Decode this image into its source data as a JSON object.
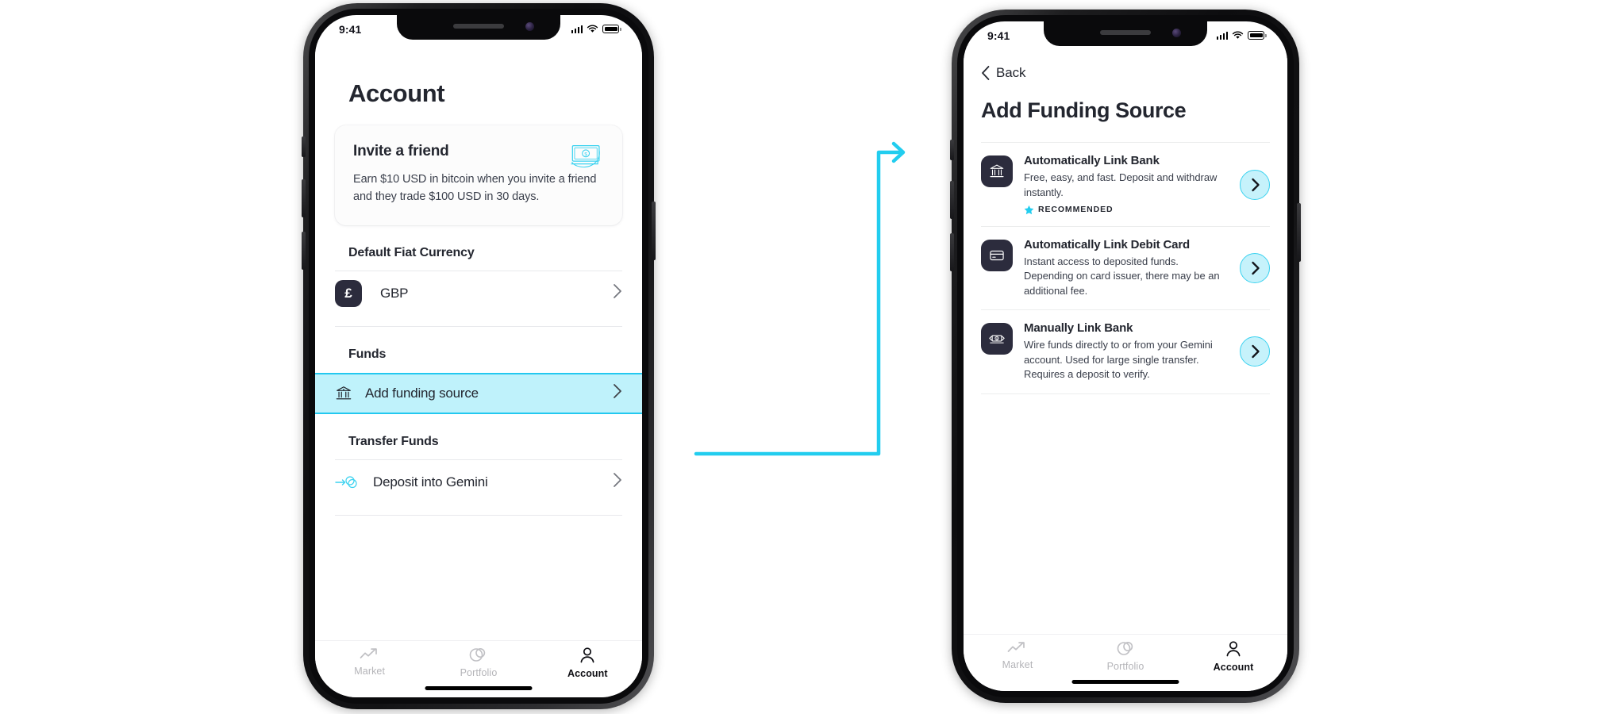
{
  "accent": "#22cdef",
  "highlight_bg": "#bff2fb",
  "dark_badge": "#2c2c3d",
  "phone1": {
    "status": {
      "time": "9:41",
      "signal": "signal-bars-icon",
      "wifi": "wifi-icon",
      "battery": "battery-full-icon"
    },
    "page_title": "Account",
    "invite": {
      "title": "Invite a friend",
      "description": "Earn $10 USD in bitcoin when you invite a friend and they trade $100 USD in 30 days.",
      "icon": "money-bill-icon"
    },
    "sections": [
      {
        "heading": "Default Fiat Currency",
        "rows": [
          {
            "badge": "£",
            "label": "GBP",
            "chevron": "chevron-right-icon",
            "highlighted": false
          }
        ]
      },
      {
        "heading": "Funds",
        "rows": [
          {
            "icon": "bank-icon",
            "label": "Add funding source",
            "chevron": "chevron-right-icon",
            "highlighted": true
          }
        ]
      },
      {
        "heading": "Transfer Funds",
        "rows": [
          {
            "icon": "deposit-arrow-icon",
            "label": "Deposit into Gemini",
            "chevron": "chevron-right-icon",
            "highlighted": false
          }
        ]
      }
    ],
    "tabs": [
      {
        "label": "Market",
        "icon": "trend-up-icon",
        "active": false
      },
      {
        "label": "Portfolio",
        "icon": "circles-icon",
        "active": false
      },
      {
        "label": "Account",
        "icon": "person-icon",
        "active": true
      }
    ]
  },
  "phone2": {
    "status": {
      "time": "9:41",
      "signal": "signal-bars-icon",
      "wifi": "wifi-icon",
      "battery": "battery-full-icon"
    },
    "back": {
      "label": "Back",
      "icon": "chevron-left-icon"
    },
    "page_title": "Add Funding Source",
    "options": [
      {
        "icon": "bank-icon",
        "title": "Automatically Link Bank",
        "description": "Free, easy, and fast. Deposit and withdraw instantly.",
        "badge": {
          "icon": "star-icon",
          "label": "RECOMMENDED"
        },
        "go": "chevron-right-circle-icon"
      },
      {
        "icon": "credit-card-icon",
        "title": "Automatically Link Debit Card",
        "description": "Instant access to deposited funds. Depending on card issuer, there may be an additional fee.",
        "badge": null,
        "go": "chevron-right-circle-icon"
      },
      {
        "icon": "wire-transfer-icon",
        "title": "Manually Link Bank",
        "description": "Wire funds directly to or from your Gemini account. Used for large single transfer. Requires a deposit to verify.",
        "badge": null,
        "go": "chevron-right-circle-icon"
      }
    ],
    "tabs": [
      {
        "label": "Market",
        "icon": "trend-up-icon",
        "active": false
      },
      {
        "label": "Portfolio",
        "icon": "circles-icon",
        "active": false
      },
      {
        "label": "Account",
        "icon": "person-icon",
        "active": true
      }
    ]
  },
  "connector": {
    "name": "flow-arrow",
    "color": "#22cdef"
  }
}
